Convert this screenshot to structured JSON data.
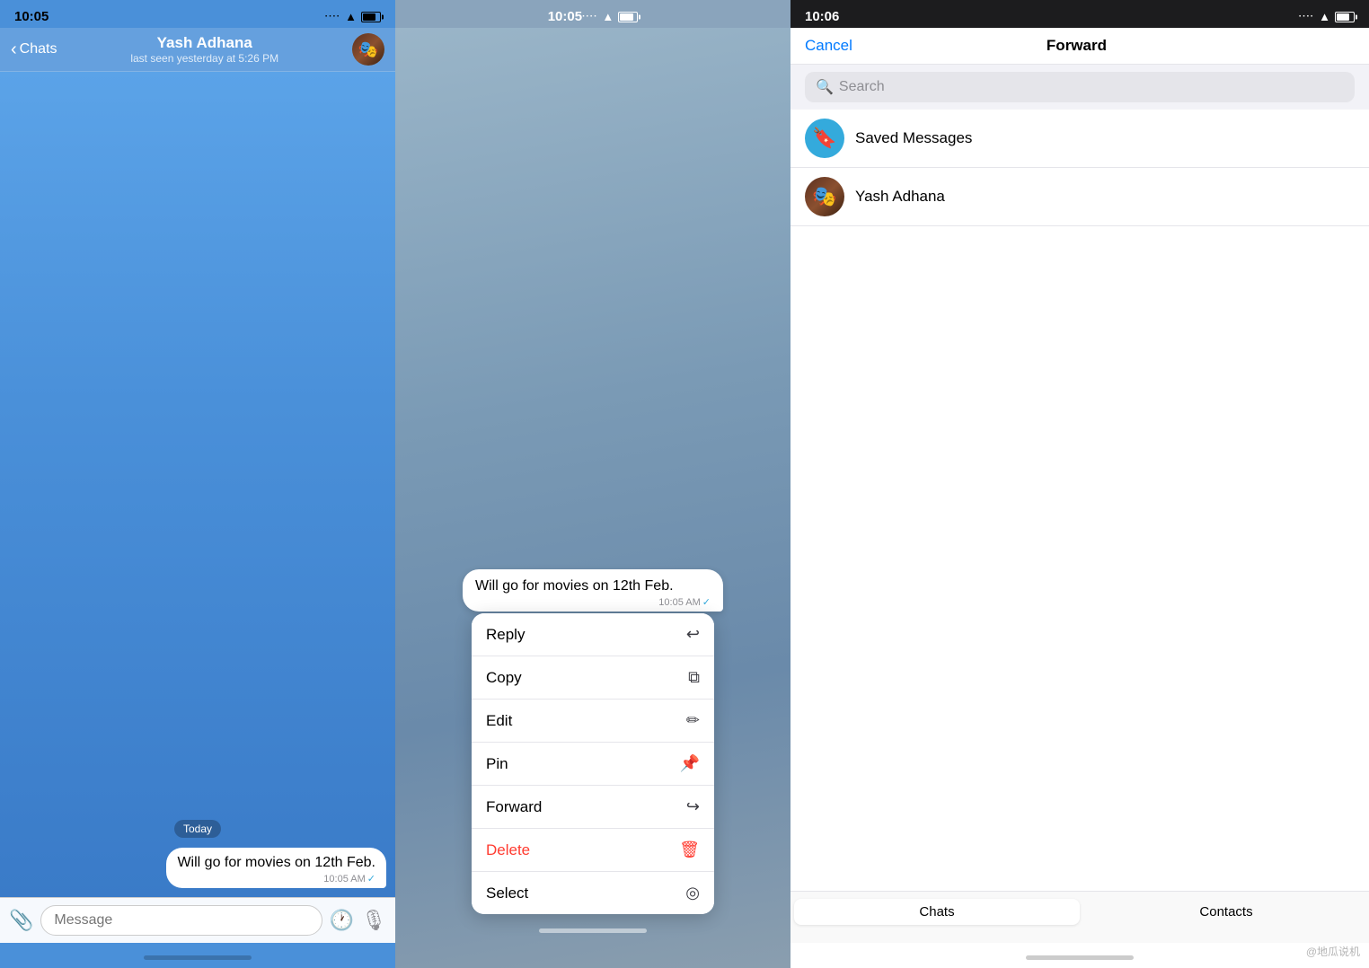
{
  "panel1": {
    "statusBar": {
      "time": "10:05",
      "signal": ".....",
      "wifi": "WiFi",
      "battery": "Battery"
    },
    "nav": {
      "backLabel": "Chats",
      "contactName": "Yash Adhana",
      "contactStatus": "last seen yesterday at 5:26 PM"
    },
    "chat": {
      "dateBadge": "Today",
      "message": "Will go for movies on 12th Feb.",
      "time": "10:05 AM",
      "checkMark": "✓"
    },
    "inputBar": {
      "placeholder": "Message"
    }
  },
  "panel2": {
    "statusBar": {
      "time": "10:05"
    },
    "message": "Will go for movies on 12th Feb.",
    "time": "10:05 AM",
    "contextMenu": {
      "items": [
        {
          "label": "Reply",
          "icon": "↩"
        },
        {
          "label": "Copy",
          "icon": "⧉"
        },
        {
          "label": "Edit",
          "icon": "✏"
        },
        {
          "label": "Pin",
          "icon": "📌"
        },
        {
          "label": "Forward",
          "icon": "↪"
        },
        {
          "label": "Delete",
          "icon": "🗑",
          "isDelete": true
        },
        {
          "label": "Select",
          "icon": "◎"
        }
      ]
    }
  },
  "panel3": {
    "statusBar": {
      "time": "10:06"
    },
    "nav": {
      "cancelLabel": "Cancel",
      "title": "Forward"
    },
    "searchPlaceholder": "Search",
    "contacts": [
      {
        "name": "Saved Messages",
        "type": "saved",
        "icon": "🔖"
      },
      {
        "name": "Yash Adhana",
        "type": "user",
        "icon": "👤"
      }
    ],
    "bottomTabs": [
      {
        "label": "Chats",
        "active": true
      },
      {
        "label": "Contacts",
        "active": false
      }
    ],
    "watermark": "@地瓜说机"
  }
}
